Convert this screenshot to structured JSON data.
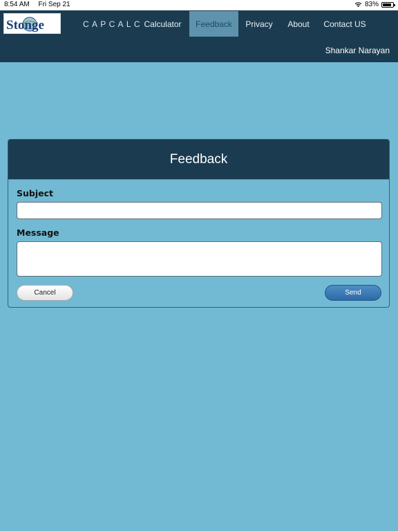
{
  "status_bar": {
    "time": "8:54 AM",
    "date": "Fri Sep 21",
    "battery_percent": "83%",
    "battery_level": 0.83,
    "wifi_icon": "wifi-icon",
    "battery_icon": "battery-icon"
  },
  "header": {
    "logo_text": "Stonge",
    "brand": "CAPCALC",
    "nav": [
      {
        "label": "Calculator",
        "active": false
      },
      {
        "label": "Feedback",
        "active": true
      },
      {
        "label": "Privacy",
        "active": false
      },
      {
        "label": "About",
        "active": false
      },
      {
        "label": "Contact US",
        "active": false
      }
    ],
    "user_name": "Shankar Narayan"
  },
  "feedback_form": {
    "title": "Feedback",
    "subject_label": "Subject",
    "subject_value": "",
    "message_label": "Message",
    "message_value": "",
    "cancel_label": "Cancel",
    "send_label": "Send"
  },
  "colors": {
    "page_background": "#72bad3",
    "header_background": "#1b3b50",
    "active_nav": "#5e93ad",
    "send_button": "#3a7bb8"
  }
}
